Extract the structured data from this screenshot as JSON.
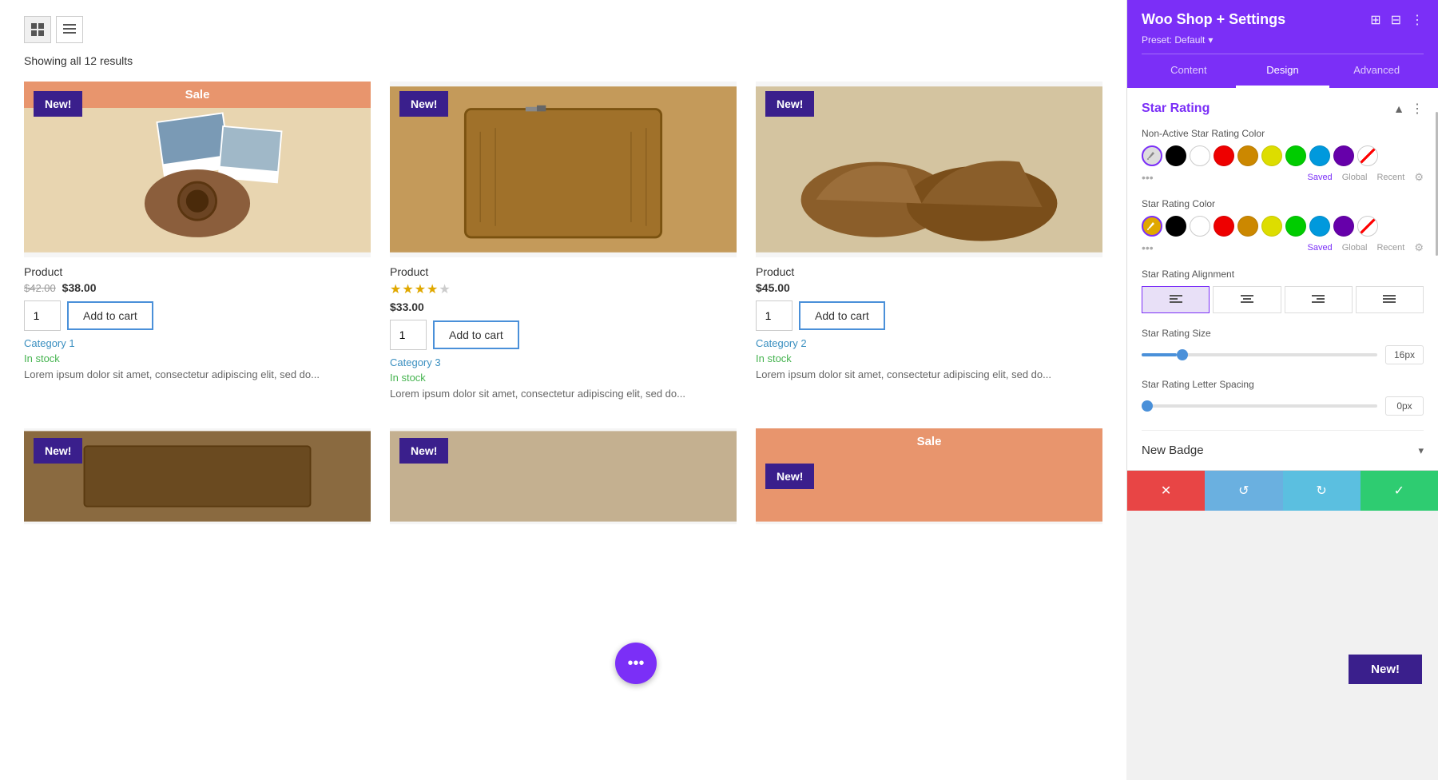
{
  "header": {
    "title": "Woo Shop + Settings",
    "preset": "Preset: Default"
  },
  "tabs": {
    "content": "Content",
    "design": "Design",
    "advanced": "Advanced",
    "active": "design"
  },
  "shop": {
    "results_count": "Showing all 12 results",
    "grid_icon": "⊞",
    "list_icon": "☰"
  },
  "products": [
    {
      "id": 1,
      "has_sale_banner": true,
      "sale_banner_text": "Sale",
      "has_new_badge": true,
      "new_badge_text": "New!",
      "name": "Product",
      "old_price": "$42.00",
      "price": "$38.00",
      "has_rating": false,
      "qty": "1",
      "add_to_cart": "Add to cart",
      "category": "Category 1",
      "in_stock": "In stock",
      "desc": "Lorem ipsum dolor sit amet, consectetur adipiscing elit, sed do...",
      "img_class": "img-product-1"
    },
    {
      "id": 2,
      "has_sale_banner": false,
      "has_new_badge": true,
      "new_badge_text": "New!",
      "name": "Product",
      "price": "$33.00",
      "has_rating": true,
      "stars_filled": 4,
      "stars_empty": 1,
      "qty": "1",
      "add_to_cart": "Add to cart",
      "category": "Category 3",
      "in_stock": "In stock",
      "desc": "Lorem ipsum dolor sit amet, consectetur adipiscing elit, sed do...",
      "img_class": "img-product-2"
    },
    {
      "id": 3,
      "has_sale_banner": false,
      "has_new_badge": true,
      "new_badge_text": "New!",
      "name": "Product",
      "price": "$45.00",
      "has_rating": false,
      "qty": "1",
      "add_to_cart": "Add to cart",
      "category": "Category 2",
      "in_stock": "In stock",
      "desc": "Lorem ipsum dolor sit amet, consectetur adipiscing elit, sed do...",
      "img_class": "img-product-3"
    },
    {
      "id": 4,
      "has_sale_banner": false,
      "has_new_badge": true,
      "new_badge_text": "New!",
      "img_class": "img-product-4"
    },
    {
      "id": 5,
      "has_sale_banner": false,
      "has_new_badge": true,
      "new_badge_text": "New!",
      "img_class": "img-product-5"
    },
    {
      "id": 6,
      "has_sale_banner": true,
      "sale_banner_text": "Sale",
      "has_new_badge": true,
      "new_badge_text": "New!",
      "img_class": "img-product-6"
    }
  ],
  "settings": {
    "star_rating_section": "Star Rating",
    "non_active_star_label": "Non-Active Star Rating Color",
    "star_rating_color_label": "Star Rating Color",
    "star_rating_alignment_label": "Star Rating Alignment",
    "star_rating_size_label": "Star Rating Size",
    "star_rating_size_value": "16px",
    "star_rating_letter_spacing_label": "Star Rating Letter Spacing",
    "star_rating_letter_spacing_value": "0px",
    "new_badge_label": "New Badge",
    "saved_tab": "Saved",
    "global_tab": "Global",
    "recent_tab": "Recent",
    "color_swatches_1": [
      "transparent",
      "#000",
      "#fff",
      "#e00",
      "#c80",
      "#dd0",
      "#0c0",
      "#09d",
      "#60a"
    ],
    "color_swatches_2": [
      "#c80",
      "#000",
      "#fff",
      "#e00",
      "#c80",
      "#dd0",
      "#0c0",
      "#09d",
      "#60a"
    ],
    "size_slider_pct": 15,
    "spacing_slider_pct": 0
  },
  "bottom_bar": {
    "cancel": "✕",
    "undo": "↺",
    "redo": "↻",
    "confirm": "✓"
  },
  "floating_btn": "•••",
  "new_badge_bottom": "New!"
}
